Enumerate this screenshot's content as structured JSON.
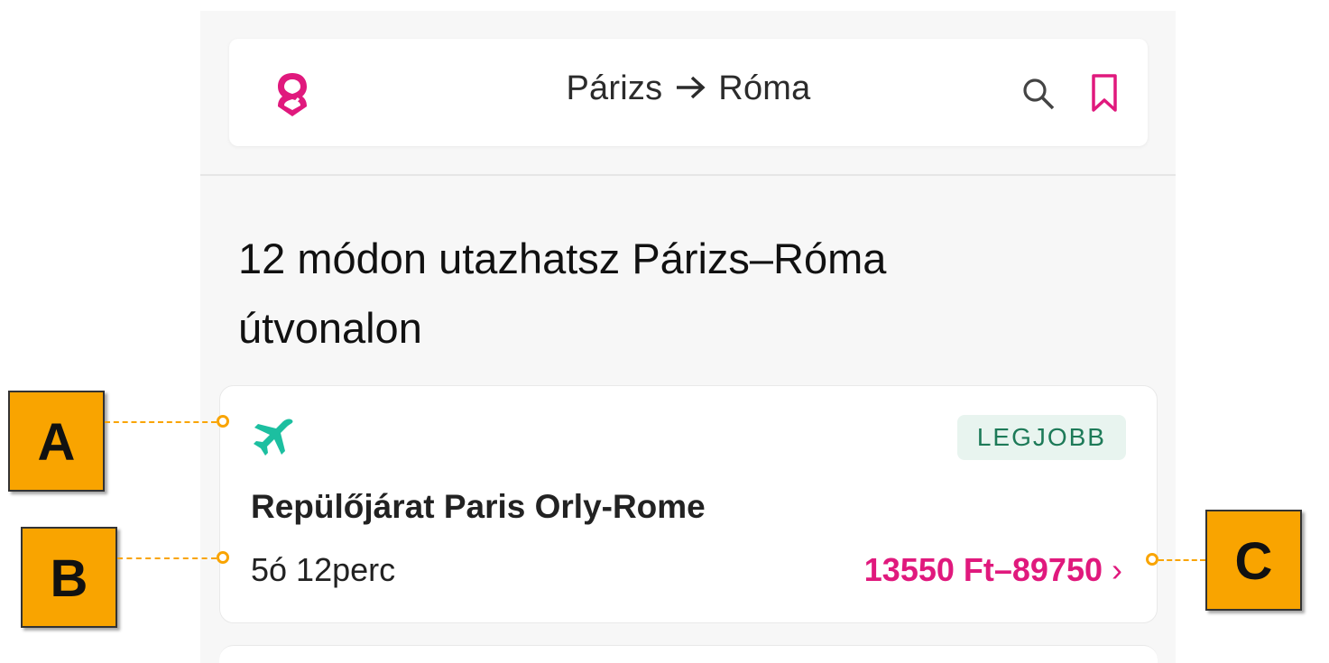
{
  "header": {
    "origin": "Párizs",
    "arrow": "→",
    "destination": "Róma"
  },
  "page_title": "12 módon utazhatsz Párizs–Róma útvonalon",
  "card": {
    "badge": "LEGJOBB",
    "title": "Repülőjárat Paris Orly-Rome",
    "duration": "5ó 12perc",
    "price": "13550 Ft–89750",
    "chevron": "›",
    "icon": "plane-icon"
  },
  "annotations": {
    "a": "A",
    "b": "B",
    "c": "C"
  },
  "colors": {
    "brand": "#e0197d",
    "accent_green": "#1cbfa0",
    "badge_bg": "#e8f4ef",
    "badge_text": "#1d7a58",
    "callout": "#f9a400"
  }
}
